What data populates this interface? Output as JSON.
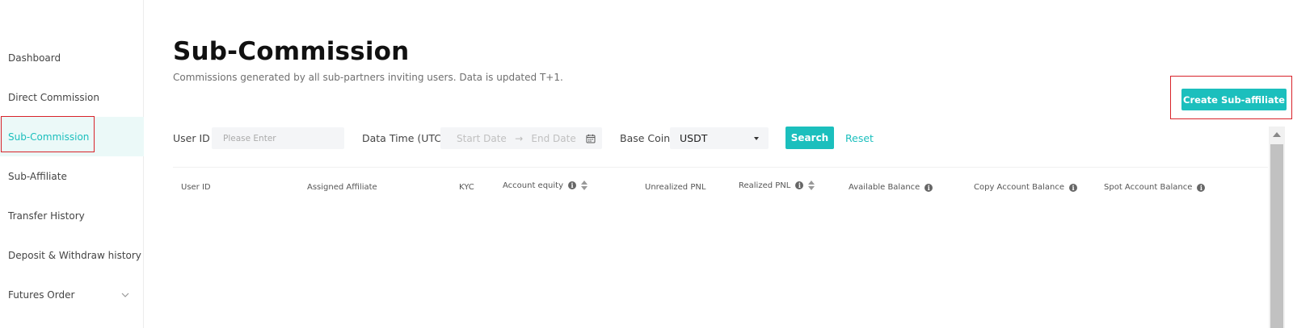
{
  "sidebar": {
    "items": [
      {
        "label": "Dashboard"
      },
      {
        "label": "Direct Commission"
      },
      {
        "label": "Sub-Commission",
        "active": true
      },
      {
        "label": "Sub-Affiliate"
      },
      {
        "label": "Transfer History"
      },
      {
        "label": "Deposit & Withdraw history"
      },
      {
        "label": "Futures Order",
        "has_submenu": true,
        "icon": "chevron-down-icon"
      }
    ]
  },
  "header": {
    "title": "Sub-Commission",
    "subtitle": "Commissions generated by all sub-partners inviting users. Data is updated T+1.",
    "create_button": "Create Sub-affiliate"
  },
  "filters": {
    "user_id_label": "User ID",
    "user_id_placeholder": "Please Enter",
    "date_label": "Data Time (UTC)",
    "start_date_placeholder": "Start Date",
    "date_separator": "→",
    "end_date_placeholder": "End Date",
    "date_icon": "calendar-icon",
    "base_coin_label": "Base Coin",
    "base_coin_value": "USDT",
    "search_button": "Search",
    "reset_link": "Reset"
  },
  "table": {
    "columns": [
      {
        "label": "User ID"
      },
      {
        "label": "Assigned Affiliate"
      },
      {
        "label": "KYC"
      },
      {
        "label": "Account equity",
        "info": true,
        "sortable": true
      },
      {
        "label": "Unrealized PNL"
      },
      {
        "label": "Realized PNL",
        "info": true,
        "sortable": true
      },
      {
        "label": "Available Balance",
        "info": true
      },
      {
        "label": "Copy Account Balance",
        "info": true
      },
      {
        "label": "Spot Account Balance",
        "info": true
      }
    ],
    "rows": []
  },
  "colors": {
    "accent": "#1bbfbd",
    "active_bg": "#ebf9f8",
    "highlight_border": "#d8232a"
  }
}
